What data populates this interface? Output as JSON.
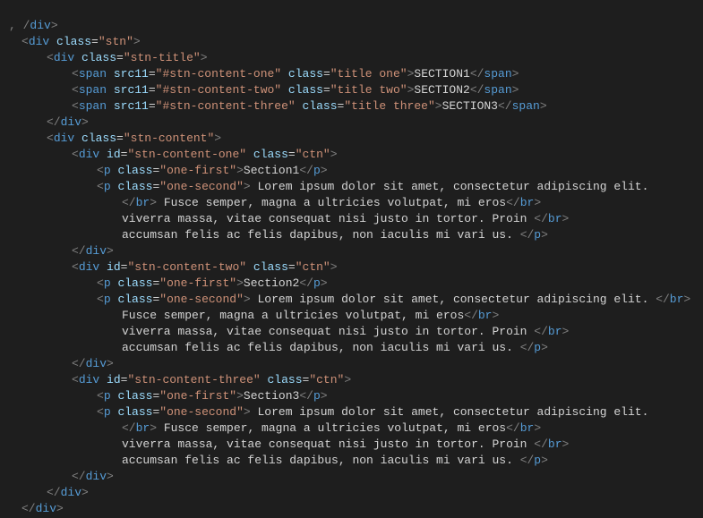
{
  "top": {
    "slashdiv_close": "/div",
    "gt": ">"
  },
  "t": {
    "lt": "<",
    "gt": ">",
    "lts": "</",
    "sgt": "/>",
    "div": "div",
    "span": "span",
    "p": "p",
    "br": "br"
  },
  "a": {
    "class": "class",
    "id": "id",
    "src11": "src11",
    "eq": "="
  },
  "v": {
    "stn": "\"stn\"",
    "stn_title": "\"stn-title\"",
    "stn_content": "\"stn-content\"",
    "stn_content_one": "\"stn-content-one\"",
    "stn_content_two": "\"stn-content-two\"",
    "stn_content_three": "\"stn-content-three\"",
    "hash_one": "\"#stn-content-one\"",
    "hash_two": "\"#stn-content-two\"",
    "hash_three": "\"#stn-content-three\"",
    "title_one": "\"title one\"",
    "title_two": "\"title two\"",
    "title_three": "\"title three\"",
    "ctn": "\"ctn\"",
    "one_first": "\"one-first\"",
    "one_second": "\"one-second\""
  },
  "text": {
    "SECTION1": "SECTION1",
    "SECTION2": "SECTION2",
    "SECTION3": "SECTION3",
    "Section1": "Section1",
    "Section2": "Section2",
    "Section3": "Section3",
    "lorem_lead": " Lorem ipsum dolor sit amet, consectetur adipiscing elit. ",
    "lorem_lead_sp": " Lorem ipsum dolor sit amet, consectetur adipiscing elit.",
    "fusce_lead": " Fusce semper, magna a ultricies volutpat, mi eros",
    "fusce": "Fusce semper, magna a ultricies volutpat, mi eros",
    "viverra": "viverra massa, vitae consequat nisi justo in tortor. Proin ",
    "accumsan": "accumsan felis ac felis dapibus, non iaculis mi vari us. "
  }
}
